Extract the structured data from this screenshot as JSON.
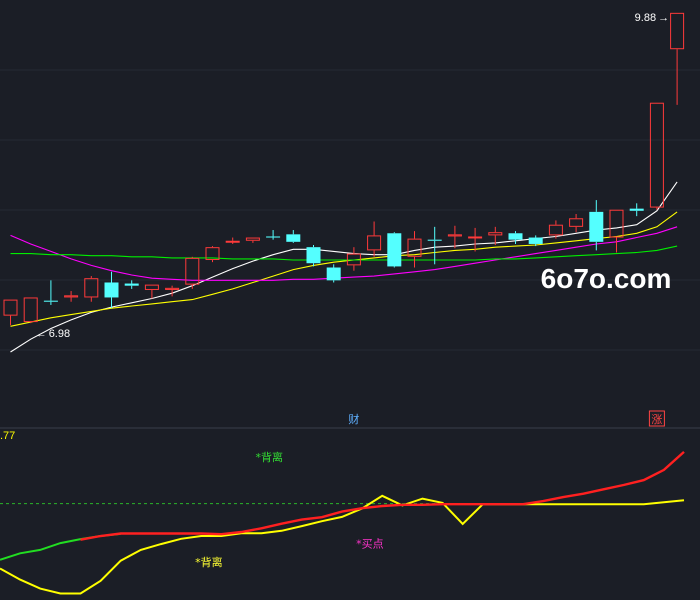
{
  "chart_data": {
    "type": "candlestick",
    "price_panel": {
      "ylim": [
        6.0,
        10.0
      ],
      "candles": [
        {
          "o": 7.05,
          "h": 7.2,
          "l": 6.96,
          "c": 7.2
        },
        {
          "o": 6.99,
          "h": 7.22,
          "l": 6.98,
          "c": 7.22
        },
        {
          "o": 7.19,
          "h": 7.38,
          "l": 7.15,
          "c": 7.18
        },
        {
          "o": 7.22,
          "h": 7.28,
          "l": 7.18,
          "c": 7.24
        },
        {
          "o": 7.22,
          "h": 7.42,
          "l": 7.18,
          "c": 7.4
        },
        {
          "o": 7.36,
          "h": 7.46,
          "l": 7.12,
          "c": 7.22
        },
        {
          "o": 7.35,
          "h": 7.38,
          "l": 7.3,
          "c": 7.33
        },
        {
          "o": 7.29,
          "h": 7.34,
          "l": 7.21,
          "c": 7.34
        },
        {
          "o": 7.29,
          "h": 7.33,
          "l": 7.23,
          "c": 7.31
        },
        {
          "o": 7.34,
          "h": 7.6,
          "l": 7.3,
          "c": 7.59
        },
        {
          "o": 7.57,
          "h": 7.7,
          "l": 7.55,
          "c": 7.69
        },
        {
          "o": 7.74,
          "h": 7.78,
          "l": 7.72,
          "c": 7.75
        },
        {
          "o": 7.75,
          "h": 7.78,
          "l": 7.73,
          "c": 7.78
        },
        {
          "o": 7.79,
          "h": 7.85,
          "l": 7.76,
          "c": 7.78
        },
        {
          "o": 7.81,
          "h": 7.85,
          "l": 7.73,
          "c": 7.74
        },
        {
          "o": 7.69,
          "h": 7.71,
          "l": 7.51,
          "c": 7.54
        },
        {
          "o": 7.5,
          "h": 7.53,
          "l": 7.36,
          "c": 7.38
        },
        {
          "o": 7.52,
          "h": 7.69,
          "l": 7.47,
          "c": 7.63
        },
        {
          "o": 7.66,
          "h": 7.93,
          "l": 7.6,
          "c": 7.8
        },
        {
          "o": 7.82,
          "h": 7.83,
          "l": 7.5,
          "c": 7.51
        },
        {
          "o": 7.6,
          "h": 7.84,
          "l": 7.5,
          "c": 7.77
        },
        {
          "o": 7.76,
          "h": 7.88,
          "l": 7.53,
          "c": 7.75
        },
        {
          "o": 7.79,
          "h": 7.89,
          "l": 7.68,
          "c": 7.81
        },
        {
          "o": 7.79,
          "h": 7.87,
          "l": 7.65,
          "c": 7.79
        },
        {
          "o": 7.8,
          "h": 7.88,
          "l": 7.71,
          "c": 7.83
        },
        {
          "o": 7.82,
          "h": 7.84,
          "l": 7.72,
          "c": 7.76
        },
        {
          "o": 7.78,
          "h": 7.8,
          "l": 7.7,
          "c": 7.72
        },
        {
          "o": 7.8,
          "h": 7.94,
          "l": 7.77,
          "c": 7.9
        },
        {
          "o": 7.88,
          "h": 8.0,
          "l": 7.83,
          "c": 7.96
        },
        {
          "o": 8.02,
          "h": 8.13,
          "l": 7.66,
          "c": 7.74
        },
        {
          "o": 7.78,
          "h": 8.04,
          "l": 7.64,
          "c": 8.04
        },
        {
          "o": 8.05,
          "h": 8.1,
          "l": 7.98,
          "c": 8.03
        },
        {
          "o": 8.06,
          "h": 9.04,
          "l": 8.04,
          "c": 9.04
        },
        {
          "o": 9.54,
          "h": 9.88,
          "l": 9.02,
          "c": 9.88
        }
      ],
      "moving_averages": [
        {
          "color": "#ffffff",
          "values": [
            6.71,
            6.83,
            6.93,
            7.01,
            7.08,
            7.13,
            7.17,
            7.21,
            7.26,
            7.33,
            7.41,
            7.49,
            7.56,
            7.62,
            7.67,
            7.67,
            7.65,
            7.63,
            7.62,
            7.62,
            7.66,
            7.69,
            7.7,
            7.72,
            7.73,
            7.75,
            7.77,
            7.79,
            7.82,
            7.85,
            7.87,
            7.9,
            8.03,
            8.3
          ]
        },
        {
          "color": "#ffff00",
          "values": [
            6.95,
            6.99,
            7.03,
            7.06,
            7.09,
            7.12,
            7.14,
            7.16,
            7.18,
            7.2,
            7.25,
            7.3,
            7.36,
            7.42,
            7.48,
            7.52,
            7.55,
            7.57,
            7.59,
            7.61,
            7.62,
            7.64,
            7.66,
            7.67,
            7.69,
            7.7,
            7.71,
            7.73,
            7.75,
            7.77,
            7.79,
            7.82,
            7.88,
            8.02
          ]
        },
        {
          "color": "#ff00ff",
          "values": [
            7.8,
            7.72,
            7.65,
            7.58,
            7.52,
            7.47,
            7.43,
            7.4,
            7.39,
            7.38,
            7.38,
            7.38,
            7.38,
            7.38,
            7.39,
            7.39,
            7.4,
            7.41,
            7.42,
            7.44,
            7.46,
            7.48,
            7.51,
            7.54,
            7.57,
            7.6,
            7.63,
            7.66,
            7.69,
            7.72,
            7.74,
            7.78,
            7.82,
            7.88
          ]
        },
        {
          "color": "#00ee00",
          "values": [
            7.63,
            7.63,
            7.62,
            7.62,
            7.61,
            7.61,
            7.6,
            7.6,
            7.59,
            7.59,
            7.59,
            7.58,
            7.58,
            7.58,
            7.57,
            7.57,
            7.57,
            7.57,
            7.57,
            7.57,
            7.57,
            7.57,
            7.57,
            7.57,
            7.58,
            7.58,
            7.59,
            7.6,
            7.61,
            7.62,
            7.63,
            7.64,
            7.66,
            7.7
          ]
        }
      ],
      "annotations": {
        "high": {
          "text": "9.88",
          "arrow": "→",
          "index": 33
        },
        "low": {
          "text": "6.98",
          "arrow": "←",
          "index": 1
        },
        "events": [
          {
            "text": "财",
            "index": 17,
            "color": "#5fb0ff"
          },
          {
            "text": "涨",
            "index": 32,
            "color": "#ff4444",
            "boxed": true
          }
        ]
      }
    },
    "indicator_panel": {
      "label": ".77",
      "label_color": "#ffff00",
      "x_count": 35,
      "red_line": [
        25.2,
        27.8,
        30.6,
        32.9,
        34.5,
        35.7,
        36.5,
        36.5,
        36.5,
        36.5,
        36.5,
        36.3,
        37.0,
        38.2,
        39.7,
        41.0,
        41.8,
        43.6,
        44.7,
        45.4,
        45.8,
        45.8,
        46.0,
        46.0,
        46.0,
        46.0,
        46.0,
        47.0,
        48.3,
        49.4,
        50.8,
        52.2,
        53.8,
        57.1,
        62.9
      ],
      "red_start": 4,
      "green_line": [
        28.0,
        30.1,
        31.2,
        33.4,
        34.7,
        35.7,
        36.4
      ],
      "yellow_line": [
        25.2,
        21.6,
        18.7,
        17.1,
        17.1,
        21.2,
        27.7,
        31.2,
        33.1,
        34.8,
        35.7,
        35.7,
        36.6,
        36.6,
        37.4,
        38.9,
        40.5,
        41.9,
        44.6,
        48.7,
        45.6,
        47.8,
        46.4,
        39.6,
        46.0,
        46.0,
        46.0,
        46.0,
        46.0,
        46.0,
        46.0,
        46.0,
        46.0,
        46.6,
        47.3
      ],
      "dashed_level": 46.2,
      "ylim": [
        15,
        70
      ],
      "labels": [
        {
          "text": "*背离",
          "color": "#33dd33",
          "index": 13,
          "value": 60.0
        },
        {
          "text": "*背离",
          "color": "#ffff33",
          "index": 10,
          "value": 26.0
        },
        {
          "text": "*买点",
          "color": "#ff33cc",
          "index": 18,
          "value": 32.0
        }
      ]
    },
    "watermark": "6o7o.com",
    "colors": {
      "up": "#ff3a3a",
      "down": "#54ffff",
      "background": "#1b1e26",
      "separator": "#3a3f4b"
    }
  }
}
